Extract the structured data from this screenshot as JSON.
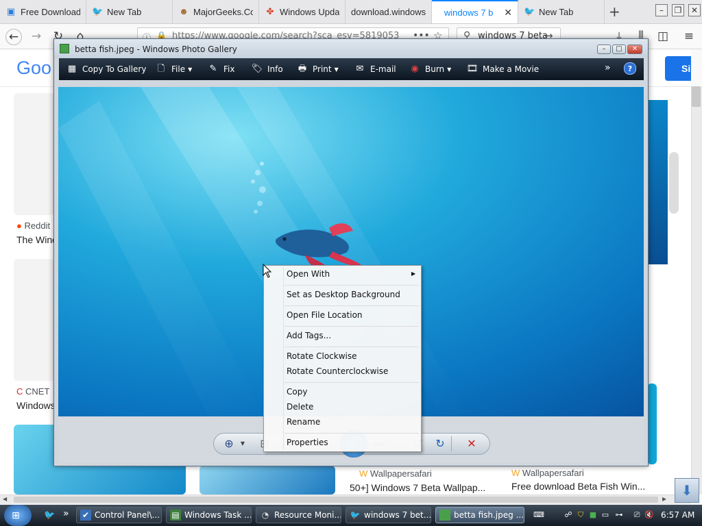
{
  "browser": {
    "tabs": [
      {
        "label": "Free Download",
        "favicon": "download-site-icon"
      },
      {
        "label": "New Tab",
        "favicon": "bird-icon"
      },
      {
        "label": "MajorGeeks.Co",
        "favicon": "majorgeeks-icon"
      },
      {
        "label": "Windows Upda",
        "favicon": "windows-logo-icon"
      },
      {
        "label": "download.windows",
        "favicon": ""
      },
      {
        "label": "windows 7 b",
        "favicon": "google-icon",
        "active": true
      },
      {
        "label": "New Tab",
        "favicon": "bird-icon"
      }
    ],
    "url": "https://www.google.com/search?sca_esv=5819053",
    "search_query": "windows 7 beta"
  },
  "google": {
    "logo": "Goo",
    "button_label": "Si",
    "results": [
      {
        "source": "Reddit",
        "title": "The Wind"
      },
      {
        "source": "CNET",
        "title": "Windows"
      },
      {
        "source": "Wallpapersafari",
        "title": "50+] Windows 7 Beta Wallpap..."
      },
      {
        "source": "Wallpapersafari",
        "title": "Free download Beta Fish Win..."
      }
    ]
  },
  "photo_gallery": {
    "title": "betta fish.jpeg - Windows Photo Gallery",
    "toolbar": {
      "copy_to_gallery": "Copy To Gallery",
      "file": "File",
      "fix": "Fix",
      "info": "Info",
      "print": "Print",
      "email": "E-mail",
      "burn": "Burn",
      "make_movie": "Make a Movie",
      "more": "»",
      "help": "?"
    }
  },
  "context_menu": {
    "items": [
      "Open With",
      "Set as Desktop Background",
      "Open File Location",
      "Add Tags...",
      "Rotate Clockwise",
      "Rotate Counterclockwise",
      "Copy",
      "Delete",
      "Rename",
      "Properties"
    ]
  },
  "taskbar": {
    "items": [
      {
        "label": "Control Panel\\...",
        "icon": "control-panel-icon"
      },
      {
        "label": "Windows Task ...",
        "icon": "task-manager-icon"
      },
      {
        "label": "Resource Moni...",
        "icon": "resource-monitor-icon"
      },
      {
        "label": "windows 7 bet...",
        "icon": "firefox-icon"
      },
      {
        "label": "betta fish.jpeg ...",
        "icon": "photo-gallery-icon",
        "active": true
      }
    ],
    "overflow": "»",
    "clock": "6:57 AM"
  },
  "colors": {
    "firefox_accent": "#0a84ff",
    "gallery_toolbar": "#1a2634",
    "taskbar": "#253240",
    "google_button": "#1a73e8"
  }
}
